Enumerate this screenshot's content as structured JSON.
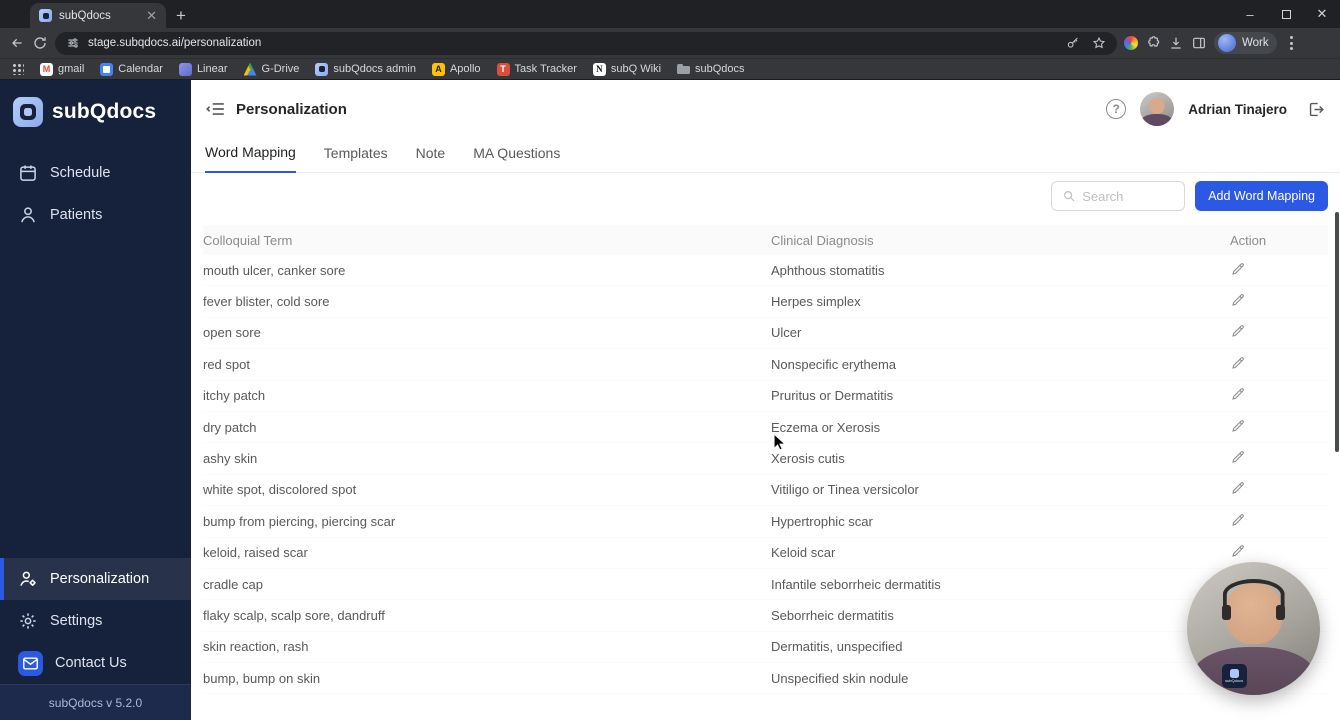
{
  "browser": {
    "tab_title": "subQdocs",
    "url": "stage.subqdocs.ai/personalization",
    "profile_label": "Work",
    "bookmarks": [
      {
        "label": "gmail",
        "icon": "gmail-icon"
      },
      {
        "label": "Calendar",
        "icon": "calendar-bookmark-icon"
      },
      {
        "label": "Linear",
        "icon": "linear-icon"
      },
      {
        "label": "G-Drive",
        "icon": "drive-icon"
      },
      {
        "label": "subQdocs admin",
        "icon": "subqdocs-admin-icon"
      },
      {
        "label": "Apollo",
        "icon": "apollo-icon"
      },
      {
        "label": "Task Tracker",
        "icon": "task-tracker-icon"
      },
      {
        "label": "subQ Wiki",
        "icon": "wiki-icon"
      },
      {
        "label": "subQdocs",
        "icon": "folder-icon"
      }
    ]
  },
  "sidebar": {
    "logo_text": "subQdocs",
    "top_items": [
      {
        "label": "Schedule",
        "icon": "calendar-icon"
      },
      {
        "label": "Patients",
        "icon": "patients-icon"
      }
    ],
    "bottom_items": [
      {
        "label": "Personalization",
        "icon": "personalization-icon",
        "active": true
      },
      {
        "label": "Settings",
        "icon": "gear-icon"
      },
      {
        "label": "Contact Us",
        "icon": "mail-icon"
      }
    ],
    "version": "subQdocs v 5.2.0"
  },
  "header": {
    "title": "Personalization",
    "help_label": "?",
    "user_name": "Adrian Tinajero"
  },
  "tabs": [
    {
      "label": "Word Mapping",
      "active": true
    },
    {
      "label": "Templates"
    },
    {
      "label": "Note"
    },
    {
      "label": "MA Questions"
    }
  ],
  "toolbar": {
    "search_placeholder": "Search",
    "add_button_label": "Add Word Mapping"
  },
  "table": {
    "columns": [
      "Colloquial Term",
      "Clinical Diagnosis",
      "Action"
    ],
    "rows": [
      {
        "term": "mouth ulcer, canker sore",
        "diagnosis": "Aphthous stomatitis"
      },
      {
        "term": "fever blister, cold sore",
        "diagnosis": "Herpes simplex"
      },
      {
        "term": "open sore",
        "diagnosis": "Ulcer"
      },
      {
        "term": "red spot",
        "diagnosis": "Nonspecific erythema"
      },
      {
        "term": "itchy patch",
        "diagnosis": "Pruritus or Dermatitis"
      },
      {
        "term": "dry patch",
        "diagnosis": "Eczema or Xerosis"
      },
      {
        "term": "ashy skin",
        "diagnosis": "Xerosis cutis"
      },
      {
        "term": "white spot, discolored spot",
        "diagnosis": "Vitiligo or Tinea versicolor"
      },
      {
        "term": "bump from piercing, piercing scar",
        "diagnosis": "Hypertrophic scar"
      },
      {
        "term": "keloid, raised scar",
        "diagnosis": "Keloid scar"
      },
      {
        "term": "cradle cap",
        "diagnosis": "Infantile seborrheic dermatitis"
      },
      {
        "term": "flaky scalp, scalp sore, dandruff",
        "diagnosis": "Seborrheic dermatitis"
      },
      {
        "term": "skin reaction, rash",
        "diagnosis": "Dermatitis, unspecified"
      },
      {
        "term": "bump, bump on skin",
        "diagnosis": "Unspecified skin nodule"
      }
    ]
  },
  "webcam": {
    "badge_text": "subQdocs"
  },
  "colors": {
    "primary": "#2B59E3",
    "sidebar": "#16213C"
  }
}
